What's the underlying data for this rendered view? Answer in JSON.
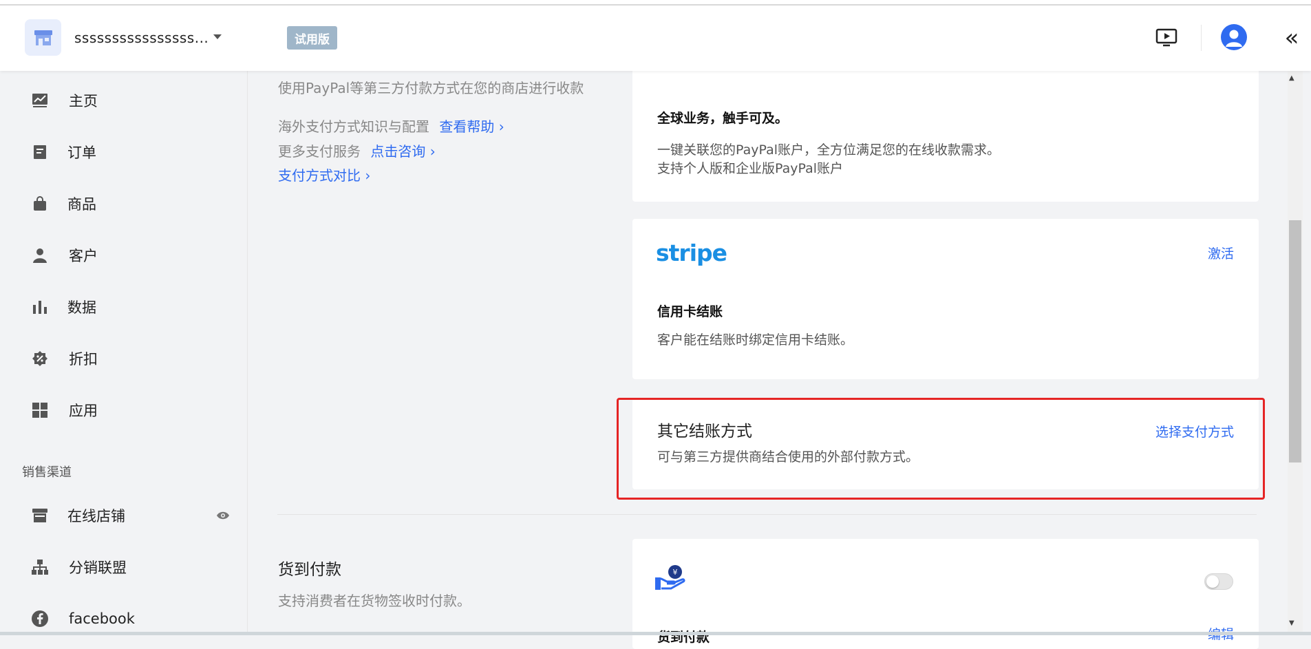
{
  "header": {
    "store_name": "ssssssssssssssss...",
    "trial_badge": "试用版"
  },
  "sidebar": {
    "items": [
      {
        "label": "主页",
        "icon": "chart-icon"
      },
      {
        "label": "订单",
        "icon": "order-icon"
      },
      {
        "label": "商品",
        "icon": "bag-icon"
      },
      {
        "label": "客户",
        "icon": "person-icon"
      },
      {
        "label": "数据",
        "icon": "bar-chart-icon"
      },
      {
        "label": "折扣",
        "icon": "discount-icon"
      },
      {
        "label": "应用",
        "icon": "grid-icon"
      }
    ],
    "section_title": "销售渠道",
    "channels": [
      {
        "label": "在线店铺",
        "icon": "store-icon"
      },
      {
        "label": "分销联盟",
        "icon": "network-icon"
      },
      {
        "label": "facebook",
        "icon": "facebook-icon"
      }
    ]
  },
  "main": {
    "left_desc": "使用PayPal等第三方付款方式在您的商店进行收款",
    "help_prefix": "海外支付方式知识与配置",
    "help_link": "查看帮助 ›",
    "consult_prefix": "更多支付服务",
    "consult_link": "点击咨询 ›",
    "compare_link": "支付方式对比 ›",
    "paypal_card": {
      "title": "全球业务，触手可及。",
      "line1": "一键关联您的PayPal账户，全方位满足您的在线收款需求。",
      "line2": "支持个人版和企业版PayPal账户"
    },
    "stripe_card": {
      "logo": "stripe",
      "action": "激活",
      "title": "信用卡结账",
      "text": "客户能在结账时绑定信用卡结账。"
    },
    "other_card": {
      "title": "其它结账方式",
      "action": "选择支付方式",
      "text": "可与第三方提供商结合使用的外部付款方式。"
    },
    "cod_section": {
      "title": "货到付款",
      "desc": "支持消费者在货物签收时付款。",
      "card_title": "货到付款",
      "card_action": "编辑",
      "toggle_on": false
    }
  },
  "colors": {
    "accent": "#2f6bf0",
    "highlight_border": "#e52424",
    "stripe_brand": "#1a8fe3"
  }
}
